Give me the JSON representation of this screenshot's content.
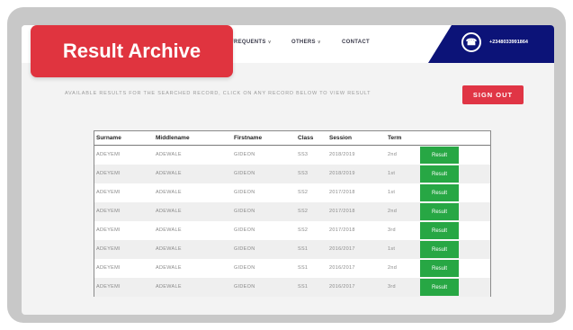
{
  "title_tag": "Result Archive",
  "nav": {
    "items": [
      {
        "label": "FREQUENTS",
        "caret": "∨"
      },
      {
        "label": "OTHERS",
        "caret": "∨"
      },
      {
        "label": "CONTACT",
        "caret": ""
      }
    ],
    "phone": "+2348033991864",
    "phone_icon": "phone-icon"
  },
  "notice": "AVAILABLE RESULTS FOR THE SEARCHED RECORD, CLICK ON ANY RECORD BELOW TO VIEW RESULT",
  "signout_label": "SIGN OUT",
  "table": {
    "headers": [
      "Surname",
      "Middlename",
      "Firstname",
      "Class",
      "Session",
      "Term"
    ],
    "action_label": "Result",
    "rows": [
      [
        "ADEYEMI",
        "ADEWALE",
        "GIDEON",
        "SS3",
        "2018/2019",
        "2nd"
      ],
      [
        "ADEYEMI",
        "ADEWALE",
        "GIDEON",
        "SS3",
        "2018/2019",
        "1st"
      ],
      [
        "ADEYEMI",
        "ADEWALE",
        "GIDEON",
        "SS2",
        "2017/2018",
        "1st"
      ],
      [
        "ADEYEMI",
        "ADEWALE",
        "GIDEON",
        "SS2",
        "2017/2018",
        "2nd"
      ],
      [
        "ADEYEMI",
        "ADEWALE",
        "GIDEON",
        "SS2",
        "2017/2018",
        "3rd"
      ],
      [
        "ADEYEMI",
        "ADEWALE",
        "GIDEON",
        "SS1",
        "2016/2017",
        "1st"
      ],
      [
        "ADEYEMI",
        "ADEWALE",
        "GIDEON",
        "SS1",
        "2016/2017",
        "2nd"
      ],
      [
        "ADEYEMI",
        "ADEWALE",
        "GIDEON",
        "SS1",
        "2016/2017",
        "3rd"
      ]
    ]
  },
  "colors": {
    "accent_red": "#e0343f",
    "nav_blue": "#0c1378",
    "result_green": "#27a744"
  }
}
